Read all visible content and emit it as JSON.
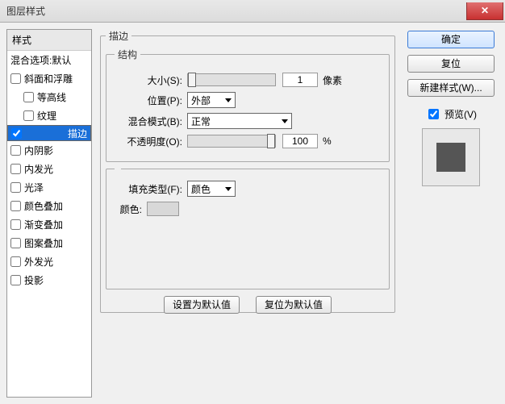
{
  "window": {
    "title": "图层样式"
  },
  "left": {
    "header": "样式",
    "blend": "混合选项:默认",
    "items": [
      {
        "label": "斜面和浮雕",
        "checked": false,
        "sub": false
      },
      {
        "label": "等高线",
        "checked": false,
        "sub": true
      },
      {
        "label": "纹理",
        "checked": false,
        "sub": true
      },
      {
        "label": "描边",
        "checked": true,
        "sub": false,
        "selected": true
      },
      {
        "label": "内阴影",
        "checked": false,
        "sub": false
      },
      {
        "label": "内发光",
        "checked": false,
        "sub": false
      },
      {
        "label": "光泽",
        "checked": false,
        "sub": false
      },
      {
        "label": "颜色叠加",
        "checked": false,
        "sub": false
      },
      {
        "label": "渐变叠加",
        "checked": false,
        "sub": false
      },
      {
        "label": "图案叠加",
        "checked": false,
        "sub": false
      },
      {
        "label": "外发光",
        "checked": false,
        "sub": false
      },
      {
        "label": "投影",
        "checked": false,
        "sub": false
      }
    ]
  },
  "center": {
    "group_title": "描边",
    "structure_title": "结构",
    "size_label": "大小(S):",
    "size_value": "1",
    "size_unit": "像素",
    "position_label": "位置(P):",
    "position_value": "外部",
    "blend_label": "混合模式(B):",
    "blend_value": "正常",
    "opacity_label": "不透明度(O):",
    "opacity_value": "100",
    "opacity_unit": "%",
    "filltype_title": "",
    "filltype_label": "填充类型(F):",
    "filltype_value": "颜色",
    "color_label": "颜色:",
    "default_btn": "设置为默认值",
    "reset_btn": "复位为默认值"
  },
  "right": {
    "ok": "确定",
    "cancel": "复位",
    "newstyle": "新建样式(W)...",
    "preview_label": "预览(V)",
    "preview_checked": true
  }
}
